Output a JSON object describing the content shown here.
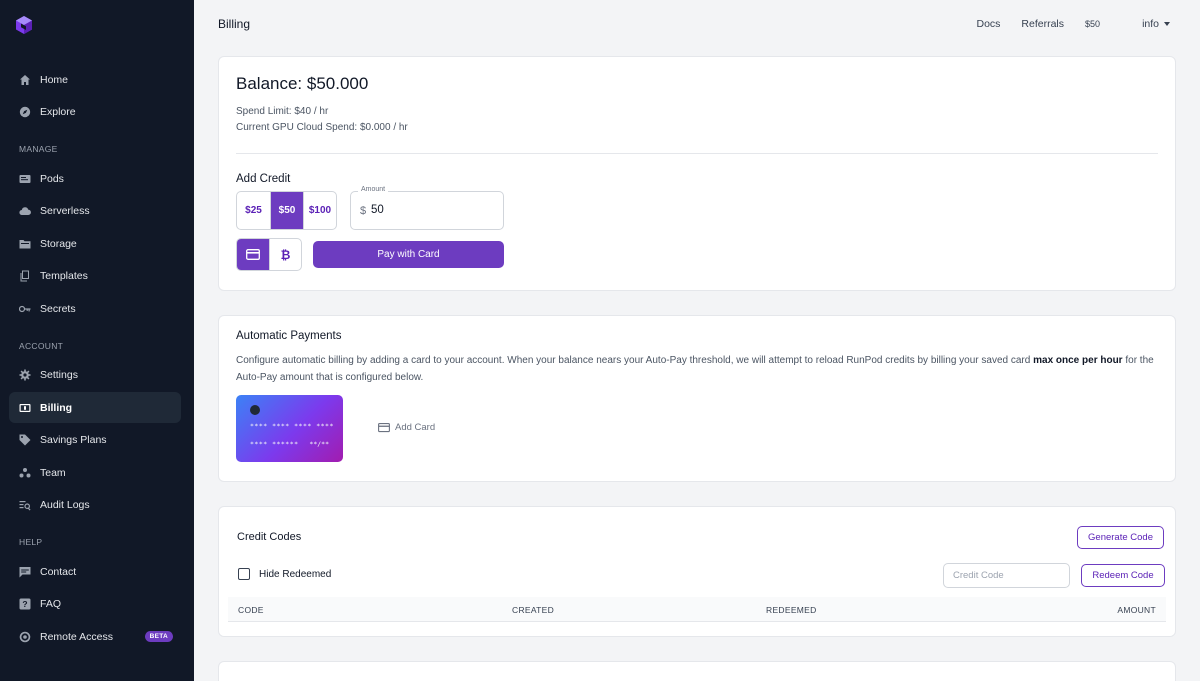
{
  "sidebar": {
    "items_top": [
      {
        "label": "Home",
        "icon": "home-icon"
      },
      {
        "label": "Explore",
        "icon": "compass-icon"
      }
    ],
    "sections": [
      {
        "title": "MANAGE",
        "items": [
          {
            "label": "Pods",
            "icon": "pods-icon"
          },
          {
            "label": "Serverless",
            "icon": "cloud-icon"
          },
          {
            "label": "Storage",
            "icon": "folder-icon"
          },
          {
            "label": "Templates",
            "icon": "template-icon"
          },
          {
            "label": "Secrets",
            "icon": "key-icon"
          }
        ]
      },
      {
        "title": "ACCOUNT",
        "items": [
          {
            "label": "Settings",
            "icon": "gear-icon"
          },
          {
            "label": "Billing",
            "icon": "billing-icon",
            "active": true
          },
          {
            "label": "Savings Plans",
            "icon": "tag-icon"
          },
          {
            "label": "Team",
            "icon": "team-icon"
          },
          {
            "label": "Audit Logs",
            "icon": "audit-icon"
          }
        ]
      },
      {
        "title": "HELP",
        "items": [
          {
            "label": "Contact",
            "icon": "chat-icon"
          },
          {
            "label": "FAQ",
            "icon": "question-icon"
          },
          {
            "label": "Remote Access",
            "icon": "globe-icon",
            "badge": "BETA"
          }
        ]
      }
    ]
  },
  "header": {
    "title": "Billing",
    "links": {
      "docs": "Docs",
      "referrals": "Referrals",
      "balance": "$50",
      "user": "info"
    }
  },
  "balance_card": {
    "balance": "Balance: $50.000",
    "spend_limit": "Spend Limit: $40 / hr",
    "gpu_spend": "Current GPU Cloud Spend: $0.000 / hr",
    "add_credit_title": "Add Credit",
    "amount_options": [
      "$25",
      "$50",
      "$100"
    ],
    "selected_amount": "$50",
    "amount_label": "Amount",
    "currency_symbol": "$",
    "amount_value": "50",
    "pay_button": "Pay with Card"
  },
  "auto_payments": {
    "title": "Automatic Payments",
    "desc_part1": "Configure automatic billing by adding a card to your account. When your balance nears your Auto-Pay threshold, we will attempt to reload RunPod credits by billing your saved card ",
    "desc_bold": "max once per hour",
    "desc_part2": " for the Auto-Pay amount that is configured below.",
    "card_number": "**** **** **** ****",
    "card_name": "**** ******",
    "card_expiry": "**/**",
    "add_card": "Add Card"
  },
  "credit_codes": {
    "title": "Credit Codes",
    "generate_button": "Generate Code",
    "hide_redeemed": "Hide Redeemed",
    "code_placeholder": "Credit Code",
    "redeem_button": "Redeem Code",
    "columns": {
      "code": "CODE",
      "created": "CREATED",
      "redeemed": "REDEEMED",
      "amount": "AMOUNT"
    }
  },
  "colors": {
    "accent": "#6d3cc0",
    "sidebar_bg": "#111827"
  }
}
